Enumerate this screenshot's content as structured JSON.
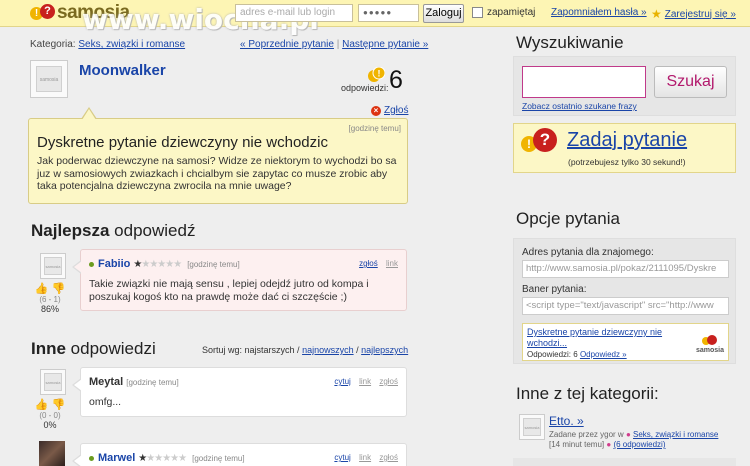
{
  "header": {
    "logo_text": "samosia",
    "watermark": "www.wiocha.pl",
    "email_placeholder": "adres e-mail lub login",
    "password_value": "●●●●●",
    "login_button": "Zaloguj",
    "remember_label": "zapamiętaj",
    "forgot_link": "Zapomniałem hasła »",
    "register_link": "Zarejestruj się »"
  },
  "breadcrumb": {
    "prefix": "Kategoria:",
    "category": "Seks, związki i romanse",
    "prev": "« Poprzednie pytanie",
    "separator": "|",
    "next": "Następne pytanie »"
  },
  "question": {
    "author": "Moonwalker",
    "answers_label": "odpowiedzi:",
    "answers_count": "6",
    "report_label": "Zgłoś",
    "time": "[godzinę temu]",
    "title": "Dyskretne pytanie dziewczyny nie wchodzic",
    "body": "Jak poderwac dziewczyne na samosi? Widze ze niektorym to wychodzi bo sa juz w samosiowych zwiazkach i chcialbym sie zapytac co musze zrobic aby taka potencjalna dziewczyna zwrocila na mnie uwage?"
  },
  "best_answer": {
    "heading_bold": "Najlepsza",
    "heading_rest": " odpowiedź",
    "author": "Fabiio",
    "time": "[godzinę temu]",
    "report": "zgłoś",
    "link": "link",
    "text": "Takie związki nie mają sensu , lepiej odejdź jutro od kompa i poszukaj kogoś kto na prawdę może dać ci szczęście ;)",
    "score": "(6 - 1)",
    "percent": "86%"
  },
  "other_answers": {
    "heading_bold": "Inne",
    "heading_rest": " odpowiedzi",
    "sort_prefix": "Sortuj wg: najstarszych /",
    "sort_newest": "najnowszych",
    "sort_sep": "/",
    "sort_best": "najlepszych",
    "items": [
      {
        "author": "Meytal",
        "time": "[godzinę temu]",
        "quote": "cytuj",
        "link": "link",
        "report": "zgłoś",
        "text": "omfg...",
        "score": "(0 - 0)",
        "percent": "0%"
      },
      {
        "author": "Marwel",
        "time": "[godzinę temu]",
        "quote": "cytuj",
        "link": "link",
        "report": "zgłoś"
      }
    ]
  },
  "sidebar": {
    "search_heading": "Wyszukiwanie",
    "search_button": "Szukaj",
    "search_last": "Zobacz ostatnio szukane frazy",
    "ask_link": "Zadaj pytanie",
    "ask_sub": "(potrzebujesz tylko 30 sekund!)",
    "options_heading": "Opcje pytania",
    "address_label": "Adres pytania dla znajomego:",
    "address_value": "http://www.samosia.pl/pokaz/2111095/Dyskre",
    "banner_label": "Baner pytania:",
    "banner_value": "<script type=\"text/javascript\" src=\"http://www",
    "card_title": "Dyskretne pytanie dziewczyny nie wchodzi...",
    "card_answers": "Odpowiedzi: 6",
    "card_answer_link": "Odpowiedz »",
    "card_logo": "samosia",
    "other_heading": "Inne z tej kategorii:",
    "other_item_title": "Etto. »",
    "other_item_meta_prefix": "Zadane przez ygor w",
    "other_item_category": "Seks, związki i romanse",
    "other_item_time": "[14 minut temu]",
    "other_item_answers": "(6 odpowiedzi)"
  },
  "colors": {
    "header_bg": "#fdf5b4",
    "link": "#1a45a8",
    "question_box": "#fcf7c6",
    "best_box": "#fdf0f0",
    "accent_pink": "#c03a8a"
  }
}
